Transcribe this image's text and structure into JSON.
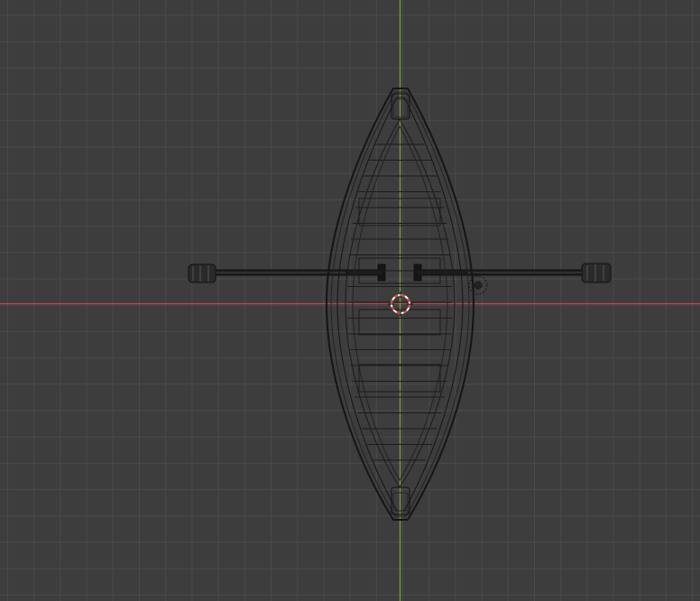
{
  "viewport": {
    "view": "top-orthographic",
    "background_color": "#3d3d3d",
    "grid_color": "#4a4a4a",
    "x_axis_color": "#d9535b",
    "y_axis_color": "#8fbf3a",
    "wire_color": "#111111"
  },
  "scene": {
    "objects": [
      {
        "name": "rowboat-hull"
      },
      {
        "name": "oar-left"
      },
      {
        "name": "oar-right"
      },
      {
        "name": "light-object"
      }
    ],
    "cursor": {
      "name": "3d-cursor",
      "colors": [
        "#e04040",
        "#ffffff"
      ]
    }
  }
}
